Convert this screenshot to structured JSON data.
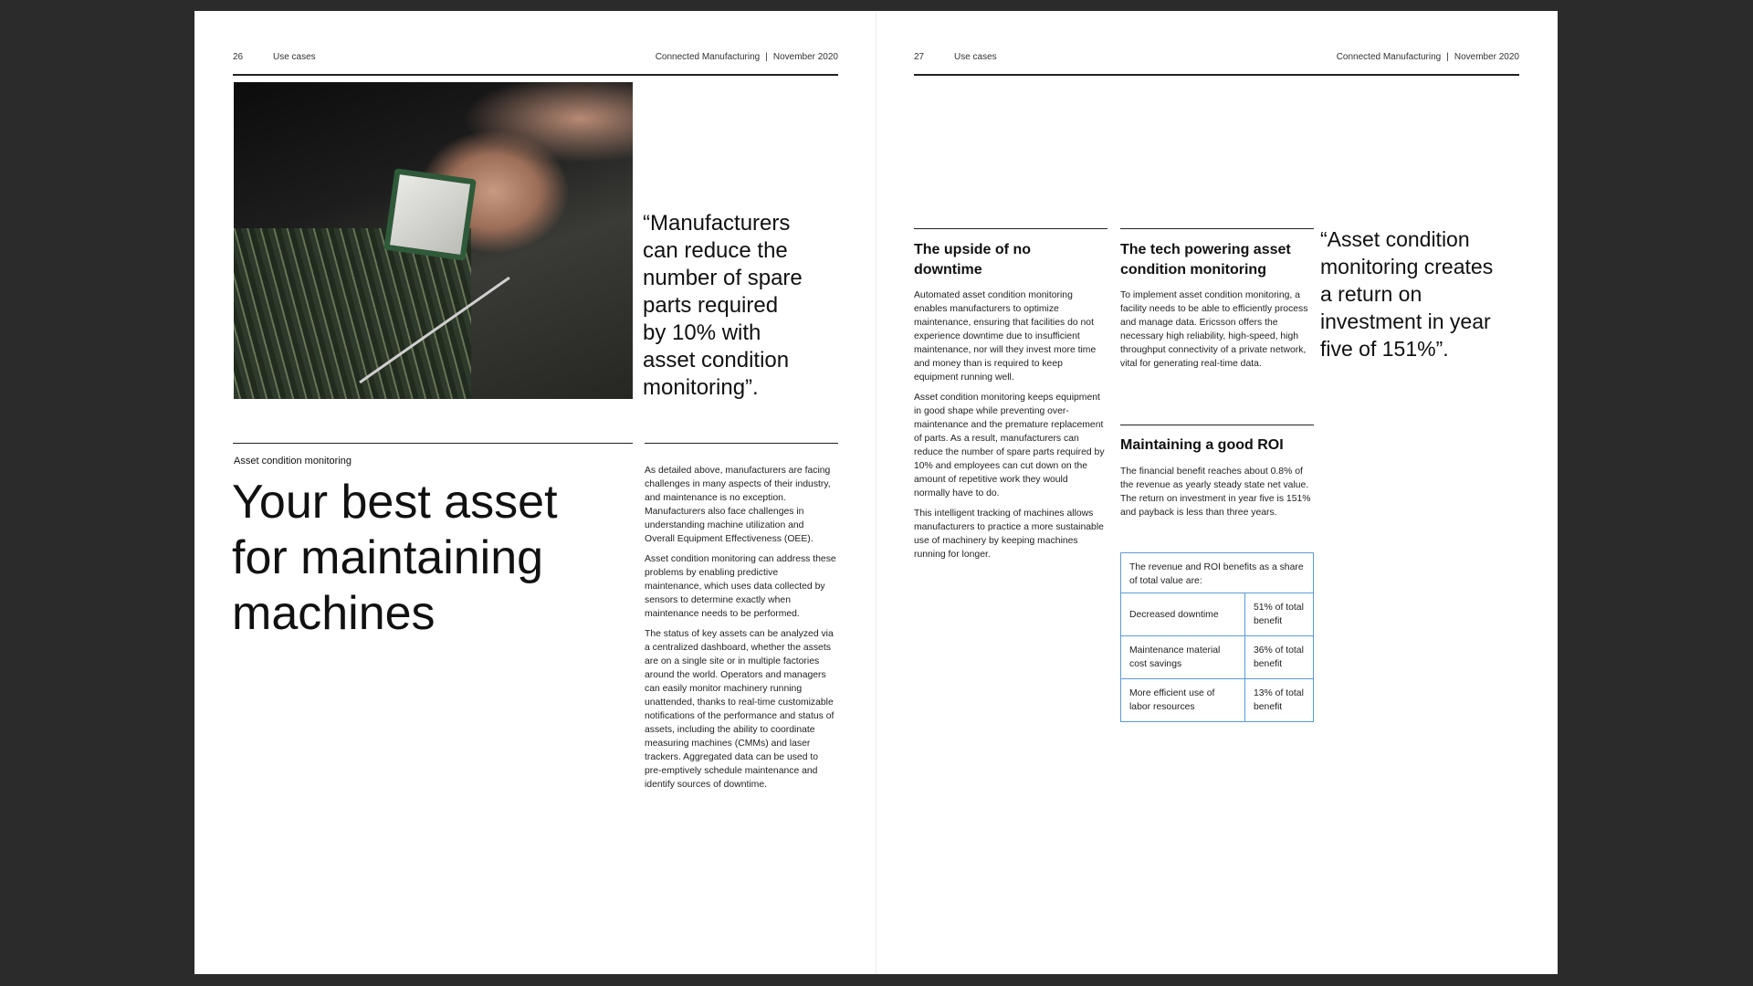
{
  "left_page": {
    "header": {
      "page_number": "26",
      "section": "Use cases",
      "publication": "Connected Manufacturing",
      "separator": "|",
      "date": "November 2020"
    },
    "quote_lines": [
      "“Manufacturers",
      "can reduce the",
      "number of spare",
      "parts required",
      "by 10% with",
      "asset condition",
      "monitoring”."
    ],
    "kicker": "Asset condition monitoring",
    "headline_lines": [
      "Your best asset",
      "for maintaining",
      "machines"
    ],
    "body_paragraphs": [
      "As detailed above, manufacturers are facing challenges in many aspects of their industry, and maintenance is no exception. Manufacturers also face challenges in understanding machine utilization and Overall Equipment Effectiveness (OEE).",
      "Asset condition monitoring can address these problems by enabling predictive maintenance, which uses data collected by sensors to determine exactly when maintenance needs to be performed.",
      "The status of key assets can be analyzed via a centralized dashboard, whether the assets are on a single site or in multiple factories around the world. Operators and managers can easily monitor machinery running unattended, thanks to real-time customizable notifications of the performance and status of assets, including the ability to coordinate measuring machines (CMMs) and laser trackers. Aggregated data can be used to pre-emptively schedule maintenance and identify sources of downtime."
    ]
  },
  "right_page": {
    "header": {
      "page_number": "27",
      "section": "Use cases",
      "publication": "Connected Manufacturing",
      "separator": "|",
      "date": "November 2020"
    },
    "col1": {
      "heading": "The upside of no downtime",
      "paragraphs": [
        "Automated asset condition monitoring enables manufacturers to optimize maintenance, ensuring that facilities do not experience downtime due to insufficient maintenance, nor will they invest more time and money than is required to keep equipment running well.",
        "Asset condition monitoring keeps equipment in good shape while preventing over-maintenance and the premature replacement of parts. As a result, manufacturers can reduce the number of spare parts required by 10% and employees can cut down on the amount of repetitive work they would normally have to do.",
        "This intelligent tracking of machines allows manufacturers to practice a more sustainable use of machinery by keeping machines running for longer."
      ]
    },
    "col2": {
      "heading": "The tech powering asset condition monitoring",
      "paragraph": "To implement asset condition monitoring, a facility needs to be able to efficiently process and manage data. Ericsson offers the necessary high reliability, high-speed, high throughput connectivity of a private network, vital for generating real-time data.",
      "roi_heading": "Maintaining a good ROI",
      "roi_paragraph": "The financial benefit reaches about 0.8% of the revenue as yearly steady state net value. The return on investment in year five is 151% and payback is less than three years."
    },
    "table": {
      "caption": "The revenue and ROI benefits as a share of total value are:",
      "rows": [
        {
          "label": "Decreased downtime",
          "value": "51% of total benefit"
        },
        {
          "label": "Maintenance material cost savings",
          "value": "36% of total benefit"
        },
        {
          "label": "More efficient use of labor resources",
          "value": "13% of total benefit"
        }
      ]
    },
    "quote_lines": [
      "“Asset condition",
      "monitoring creates",
      "a return on",
      "investment in year",
      "five of 151%”."
    ]
  },
  "colors": {
    "background": "#2b2b2b",
    "page": "#ffffff",
    "table_border": "#5b9bd5"
  }
}
